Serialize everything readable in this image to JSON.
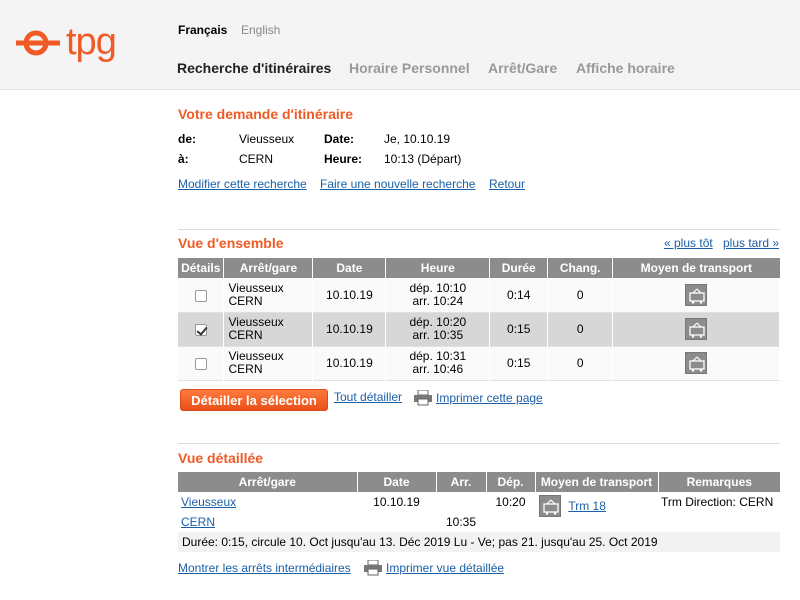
{
  "header": {
    "logo_text": "tpg",
    "lang_fr": "Français",
    "lang_en": "English",
    "nav": [
      "Recherche d'itinéraires",
      "Horaire Personnel",
      "Arrêt/Gare",
      "Affiche horaire"
    ]
  },
  "request": {
    "title": "Votre demande d'itinéraire",
    "from_label": "de:",
    "from_value": "Vieusseux",
    "to_label": "à:",
    "to_value": "CERN",
    "date_label": "Date:",
    "date_value": "Je, 10.10.19",
    "time_label": "Heure:",
    "time_value": "10:13 (Départ)",
    "links": [
      "Modifier cette recherche",
      "Faire une nouvelle recherche",
      "Retour"
    ]
  },
  "overview": {
    "title": "Vue d'ensemble",
    "earlier": "« plus tôt",
    "later": "plus tard »",
    "headers": [
      "Détails",
      "Arrêt/gare",
      "Date",
      "Heure",
      "Durée",
      "Chang.",
      "Moyen de transport"
    ],
    "rows": [
      {
        "from": "Vieusseux",
        "to": "CERN",
        "date": "10.10.19",
        "dep": "dép. 10:10",
        "arr": "arr. 10:24",
        "duration": "0:14",
        "changes": "0",
        "checked": false
      },
      {
        "from": "Vieusseux",
        "to": "CERN",
        "date": "10.10.19",
        "dep": "dép. 10:20",
        "arr": "arr. 10:35",
        "duration": "0:15",
        "changes": "0",
        "checked": true
      },
      {
        "from": "Vieusseux",
        "to": "CERN",
        "date": "10.10.19",
        "dep": "dép. 10:31",
        "arr": "arr. 10:46",
        "duration": "0:15",
        "changes": "0",
        "checked": false
      }
    ],
    "detail_button": "Détailler la sélection",
    "all_details": "Tout détailler",
    "print_page": "Imprimer cette page"
  },
  "detail": {
    "title": "Vue détaillée",
    "headers": [
      "Arrêt/gare",
      "Date",
      "Arr.",
      "Dép.",
      "Moyen de transport",
      "Remarques"
    ],
    "from_stop": "Vieusseux",
    "from_date": "10.10.19",
    "from_dep": "10:20",
    "line": "Trm 18",
    "remark": "Trm Direction: CERN",
    "to_stop": "CERN",
    "to_arr": "10:35",
    "note": "Durée: 0:15, circule 10. Oct jusqu'au 13. Déc 2019 Lu - Ve; pas 21. jusqu'au 25. Oct 2019",
    "show_stops": "Montrer les arrêts intermédiaires",
    "print_detail": "Imprimer vue détaillée"
  },
  "colors": {
    "accent": "#f05a24",
    "link": "#1a5fa8",
    "table_header": "#8c8c8c"
  }
}
